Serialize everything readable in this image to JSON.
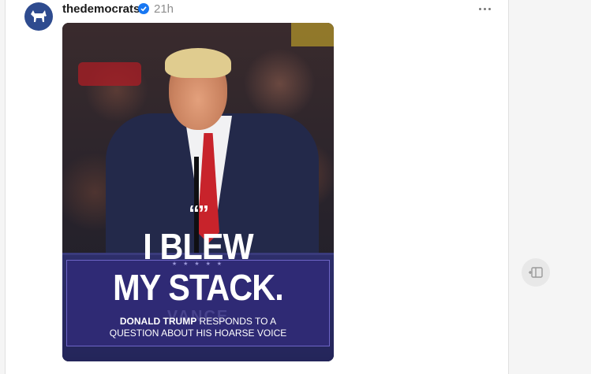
{
  "post": {
    "username": "thedemocrats",
    "verified": true,
    "timestamp": "21h",
    "more_icon": "more-horizontal-icon",
    "avatar_icon": "donkey-logo-icon"
  },
  "media": {
    "quote_glyph": "“”",
    "headline_line1": "I BLEW",
    "headline_line2": "MY STACK.",
    "stars": "★ ★ ★ ★ ★",
    "podium_text": "VANCE",
    "caption_bold": "DONALD TRUMP",
    "caption_rest_line1": " RESPONDS TO A",
    "caption_line2": "QUESTION ABOUT HIS HOARSE VOICE"
  },
  "side": {
    "button_icon": "sidebar-expand-icon"
  },
  "colors": {
    "avatar_bg": "#2e4b8f",
    "verified": "#1877f2",
    "overlay": "#302a76",
    "tie": "#c8232b"
  }
}
